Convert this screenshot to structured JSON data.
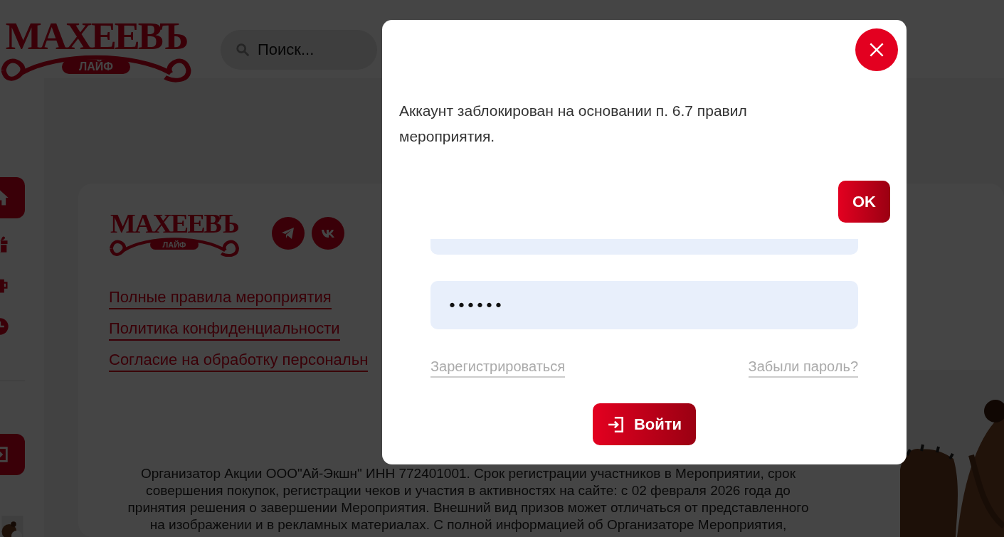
{
  "header": {
    "logo": {
      "name": "МАХЕЕВЪ",
      "tag": "ЛАЙФ"
    },
    "search": {
      "placeholder": "Поиск..."
    }
  },
  "sidebar": {
    "items": [
      {
        "kind": "home",
        "selected": true
      },
      {
        "kind": "gift",
        "selected": false
      },
      {
        "kind": "cup",
        "selected": false
      },
      {
        "kind": "clock",
        "selected": false
      }
    ],
    "login": {
      "kind": "login"
    }
  },
  "footer": {
    "logo": {
      "name": "МАХЕЕВЪ",
      "tag": "ЛАЙФ"
    },
    "socials": [
      {
        "kind": "telegram"
      },
      {
        "kind": "vk"
      }
    ],
    "links": [
      "Полные правила мероприятия",
      "Политика конфиденциальности",
      "Согласие на обработку персональн"
    ],
    "legal": [
      "Организатор Акции ООО\"Ай-Экшн\" ИНН 772401001. Срок регистрации участников в Мероприятии, срок",
      "совершения покупок, регистрации чеков и участия в активностях на сайте: с 02 февраля 2026 года до",
      "принятия решения о завершении Мероприятия. Внешний вид призов может отличаться от представленного",
      "на изображении и в рекламных материалах. С полной информацией об Организаторе Мероприятия,"
    ]
  },
  "dialog": {
    "message": "Аккаунт заблокирован на основании п. 6.7 правил мероприятия.",
    "ok": "OK",
    "form": {
      "password": "••••••",
      "register": "Зарегистрироваться",
      "forgot": "Забыли пароль?",
      "submit": "Войти"
    }
  }
}
